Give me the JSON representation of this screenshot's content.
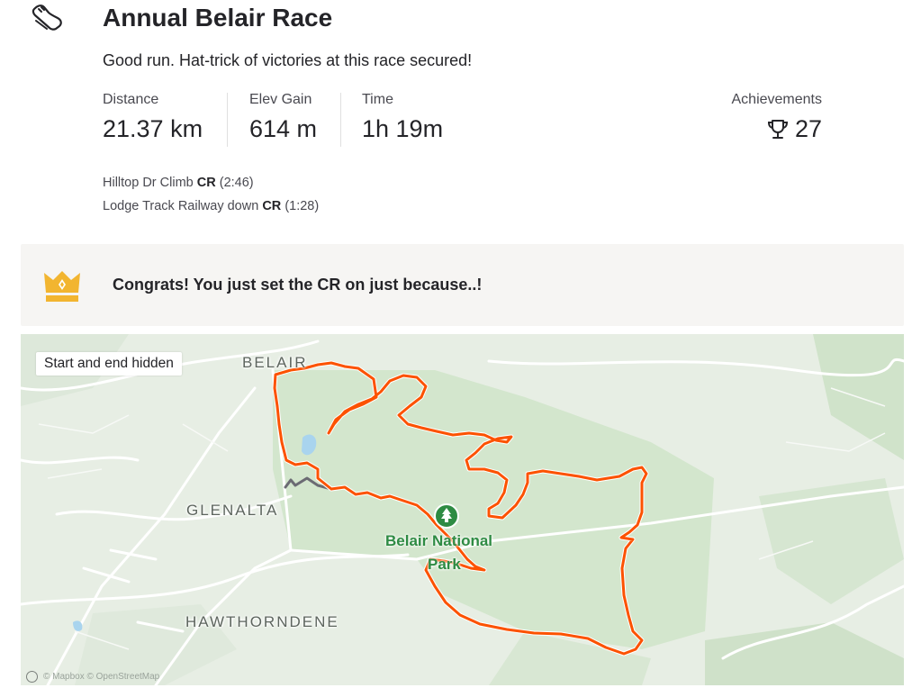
{
  "activity": {
    "icon": "run-shoe-icon",
    "title": "Annual Belair Race",
    "description": "Good run. Hat-trick of victories at this race secured!"
  },
  "stats": {
    "distance": {
      "label": "Distance",
      "value": "21.37 km"
    },
    "elev_gain": {
      "label": "Elev Gain",
      "value": "614 m"
    },
    "time": {
      "label": "Time",
      "value": "1h 19m"
    },
    "achievements": {
      "label": "Achievements",
      "value": "27",
      "icon": "trophy-icon"
    }
  },
  "segments": [
    {
      "name": "Hilltop Dr Climb",
      "badge": "CR",
      "time": "(2:46)"
    },
    {
      "name": "Lodge Track Railway down",
      "badge": "CR",
      "time": "(1:28)"
    }
  ],
  "banner": {
    "icon": "crown-icon",
    "text": "Congrats! You just set the CR on just because..!",
    "accent_color": "#f2b530",
    "background": "#f6f5f3"
  },
  "map": {
    "hidden_notice": "Start and end hidden",
    "places": [
      "BELAIR",
      "GLENALTA",
      "HAWTHORNDENE"
    ],
    "park_name_line1": "Belair National",
    "park_name_line2": "Park",
    "attribution": "© Mapbox © OpenStreetMap",
    "route_color": "#fc5200",
    "hidden_route_color": "#6b6b73"
  }
}
